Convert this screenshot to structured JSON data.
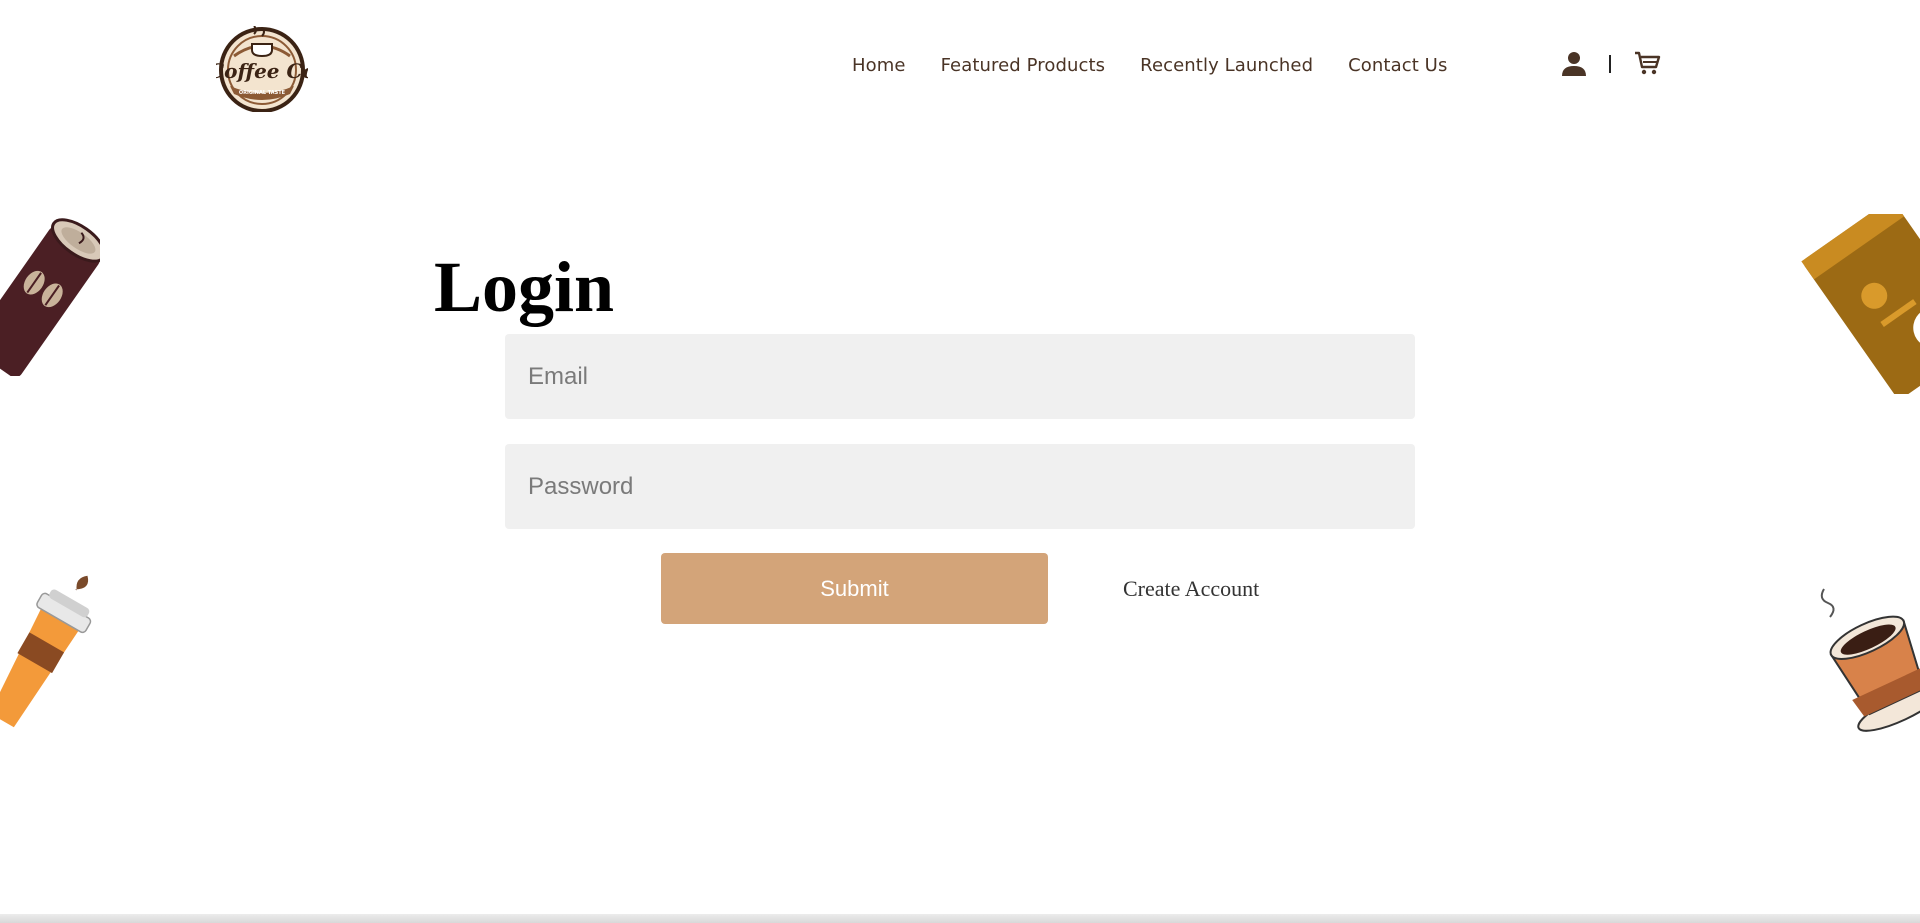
{
  "brand": {
    "logo_text": "Coffee Co",
    "logo_tagline": "ORIGINAL TASTE"
  },
  "nav": {
    "items": [
      {
        "label": "Home"
      },
      {
        "label": "Featured Products"
      },
      {
        "label": "Recently Launched"
      },
      {
        "label": "Contact Us"
      }
    ],
    "divider": "|"
  },
  "icons": {
    "account": "user-icon",
    "cart": "cart-icon"
  },
  "login": {
    "title": "Login",
    "email_placeholder": "Email",
    "password_placeholder": "Password",
    "submit_label": "Submit",
    "create_account_label": "Create Account"
  },
  "colors": {
    "accent": "#d3a479",
    "field_bg": "#f0f0f0",
    "nav_text": "#4a3426"
  }
}
